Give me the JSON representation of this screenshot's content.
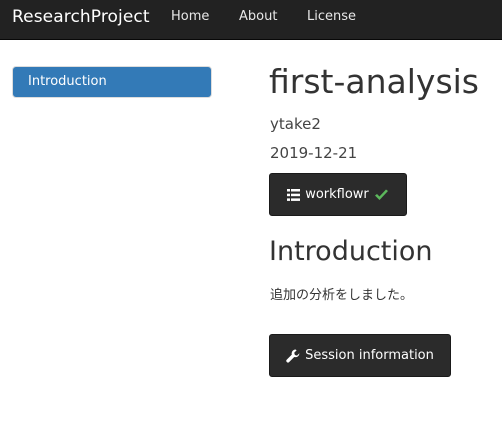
{
  "navbar": {
    "brand": "ResearchProject",
    "links": [
      "Home",
      "About",
      "License"
    ]
  },
  "toc": {
    "items": [
      {
        "label": "Introduction",
        "active": true
      }
    ]
  },
  "header": {
    "title": "first-analysis",
    "author": "ytake2",
    "date": "2019-12-21"
  },
  "workflowr_button": {
    "label": "workflowr",
    "icon": "list-icon",
    "status_icon": "checkmark-icon",
    "status_color": "#5cb85c"
  },
  "section": {
    "heading": "Introduction",
    "text": "追加の分析をしました。"
  },
  "session_button": {
    "label": "Session information",
    "icon": "wrench-icon"
  },
  "colors": {
    "navbar_bg": "#222222",
    "toc_active_bg": "#337ab7",
    "button_bg": "#2b2b2b"
  }
}
